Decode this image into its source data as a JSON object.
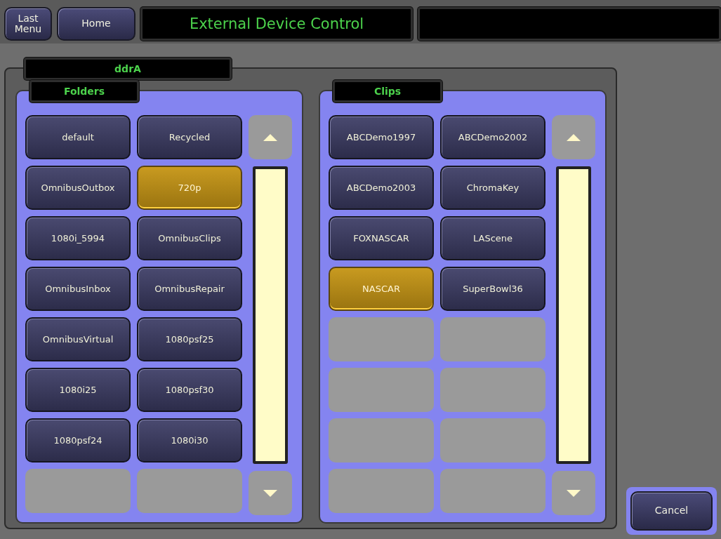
{
  "top_bar": {
    "last_menu": "Last\nMenu",
    "home": "Home",
    "title": "External Device Control"
  },
  "device": {
    "name": "ddrA"
  },
  "panels": [
    {
      "title": "Folders",
      "items": [
        {
          "kind": "button",
          "label": "default",
          "selected": false
        },
        {
          "kind": "button",
          "label": "Recycled",
          "selected": false
        },
        {
          "kind": "button",
          "label": "OmnibusOutbox",
          "selected": false
        },
        {
          "kind": "button",
          "label": "720p",
          "selected": true
        },
        {
          "kind": "button",
          "label": "1080i_5994",
          "selected": false
        },
        {
          "kind": "button",
          "label": "OmnibusClips",
          "selected": false
        },
        {
          "kind": "button",
          "label": "OmnibusInbox",
          "selected": false
        },
        {
          "kind": "button",
          "label": "OmnibusRepair",
          "selected": false
        },
        {
          "kind": "button",
          "label": "OmnibusVirtual",
          "selected": false
        },
        {
          "kind": "button",
          "label": "1080psf25",
          "selected": false
        },
        {
          "kind": "button",
          "label": "1080i25",
          "selected": false
        },
        {
          "kind": "button",
          "label": "1080psf30",
          "selected": false
        },
        {
          "kind": "button",
          "label": "1080psf24",
          "selected": false
        },
        {
          "kind": "button",
          "label": "1080i30",
          "selected": false
        },
        {
          "kind": "empty"
        },
        {
          "kind": "empty"
        }
      ]
    },
    {
      "title": "Clips",
      "items": [
        {
          "kind": "button",
          "label": "ABCDemo1997",
          "selected": false
        },
        {
          "kind": "button",
          "label": "ABCDemo2002",
          "selected": false
        },
        {
          "kind": "button",
          "label": "ABCDemo2003",
          "selected": false
        },
        {
          "kind": "button",
          "label": "ChromaKey",
          "selected": false
        },
        {
          "kind": "button",
          "label": "FOXNASCAR",
          "selected": false
        },
        {
          "kind": "button",
          "label": "LAScene",
          "selected": false
        },
        {
          "kind": "button",
          "label": "NASCAR",
          "selected": true
        },
        {
          "kind": "button",
          "label": "SuperBowl36",
          "selected": false
        },
        {
          "kind": "empty"
        },
        {
          "kind": "empty"
        },
        {
          "kind": "empty"
        },
        {
          "kind": "empty"
        },
        {
          "kind": "empty"
        },
        {
          "kind": "empty"
        },
        {
          "kind": "empty"
        },
        {
          "kind": "empty"
        }
      ]
    }
  ],
  "cancel": "Cancel"
}
